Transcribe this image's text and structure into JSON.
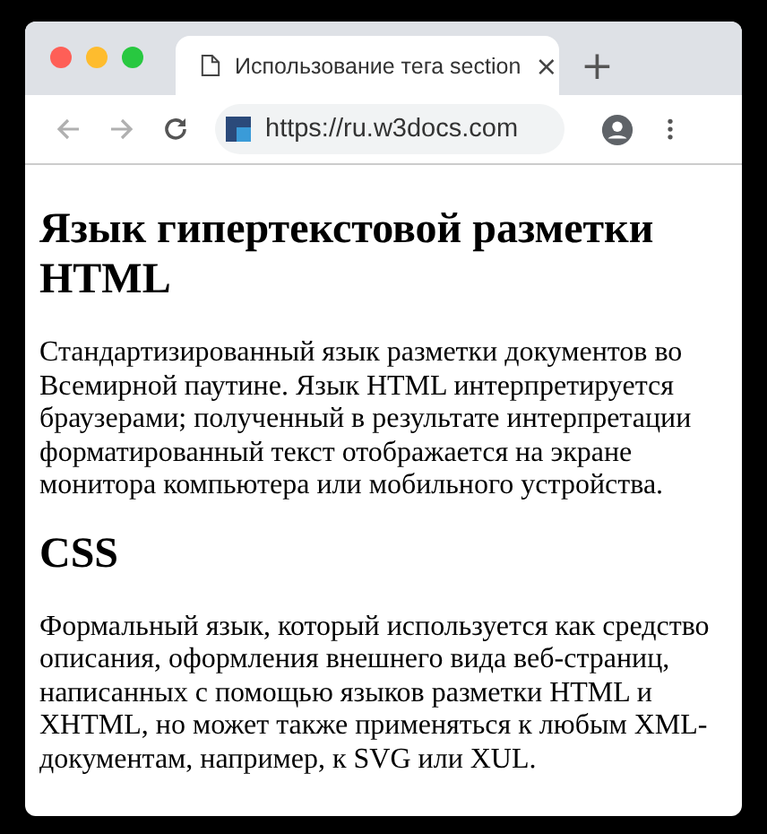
{
  "window": {
    "controls": [
      {
        "color": "#fe5f57"
      },
      {
        "color": "#febc2e"
      },
      {
        "color": "#28c840"
      }
    ]
  },
  "tabs": [
    {
      "title": "Использование тега section",
      "close": "×",
      "selected": true
    }
  ],
  "new_tab": "+",
  "toolbar": {
    "url": "https://ru.w3docs.com"
  },
  "sections": [
    {
      "heading": "Язык гипертекстовой разметки HTML",
      "text": "Стандартизированный язык разметки документов во Всемирной паутине. Язык HTML интерпретируется браузерами; полученный в результате интерпретации форматированный текст отображается на экране монитора компьютера или мобильного устройства."
    },
    {
      "heading": "CSS",
      "text": "Формальный язык, который используется как средство описания, оформления внешнего вида веб-страниц, написанных с помощью языков разметки HTML и XHTML, но может также применяться к любым XML-документам, например, к SVG или XUL."
    }
  ]
}
